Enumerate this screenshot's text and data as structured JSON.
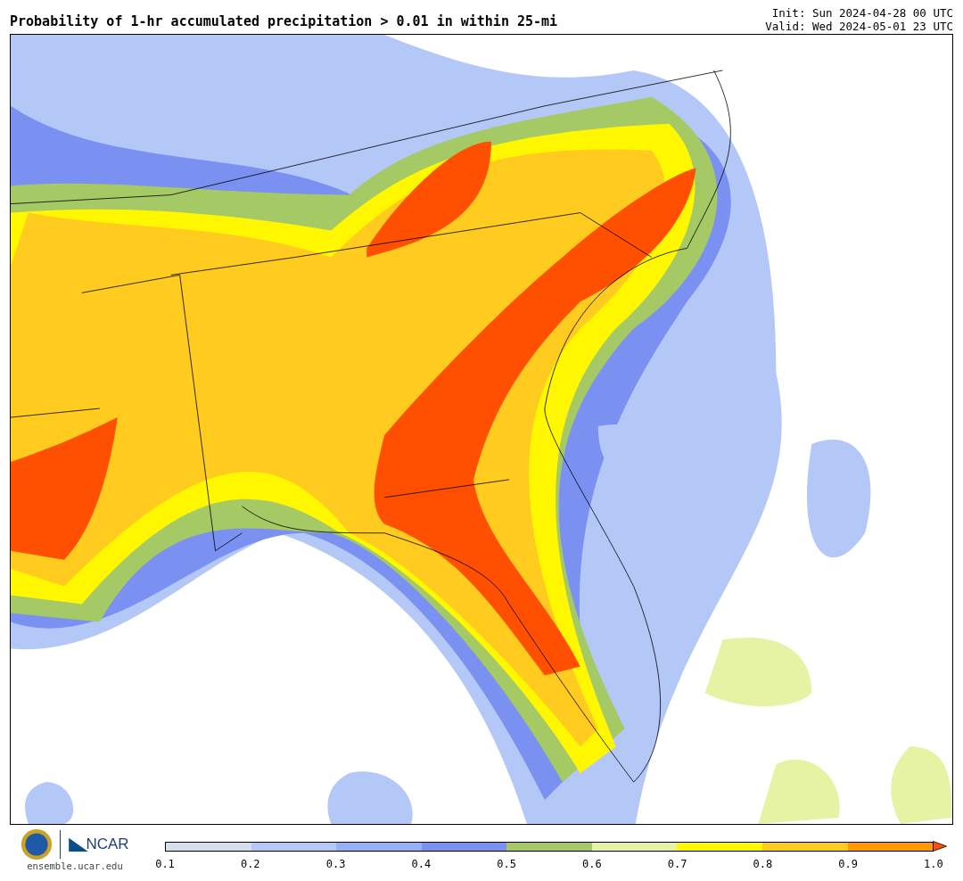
{
  "title": "Probability of 1-hr accumulated precipitation > 0.01 in within 25-mi",
  "init": "Init: Sun 2024-04-28 00 UTC",
  "valid": "Valid: Wed 2024-05-01 23 UTC",
  "logo": {
    "org": "NCAR",
    "url": "ensemble.ucar.edu"
  },
  "colorbar": {
    "bins": [
      {
        "color": "#d5e0ec"
      },
      {
        "color": "#b4c8f8"
      },
      {
        "color": "#97b0f5"
      },
      {
        "color": "#7a91f2"
      },
      {
        "color": "#a5c964"
      },
      {
        "color": "#e6f3a5"
      },
      {
        "color": "#fff700"
      },
      {
        "color": "#ffcb1e"
      },
      {
        "color": "#ff9a00"
      }
    ],
    "ticks": [
      "0.1",
      "0.2",
      "0.3",
      "0.4",
      "0.5",
      "0.6",
      "0.7",
      "0.8",
      "0.9",
      "1.0"
    ]
  }
}
